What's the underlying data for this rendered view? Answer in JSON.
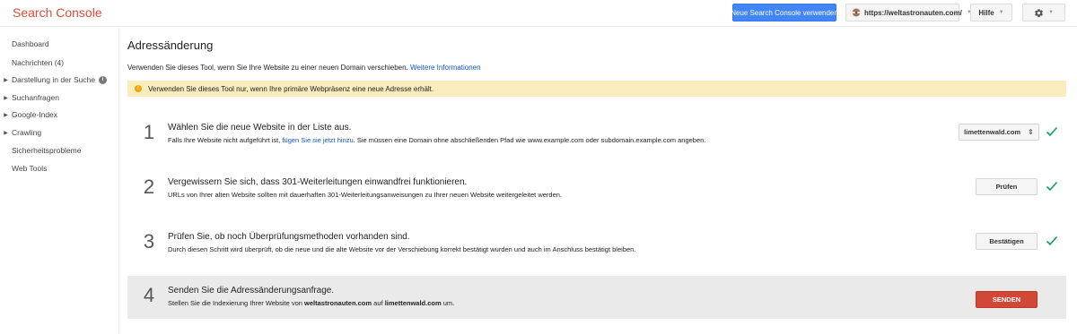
{
  "header": {
    "app_title": "Search Console",
    "new_console_button": "Neue Search Console verwenden",
    "site_selector": "https://weltastronauten.com/",
    "help_button": "Hilfe",
    "settings_icon": "gear-icon",
    "brand_color": "#dd4b39",
    "accent_color": "#4285f4"
  },
  "sidebar": {
    "items": [
      {
        "label": "Dashboard",
        "expandable": false
      },
      {
        "label": "Nachrichten (4)",
        "expandable": false
      },
      {
        "label": "Darstellung in der Suche",
        "expandable": true,
        "info_icon": true
      },
      {
        "label": "Suchanfragen",
        "expandable": true
      },
      {
        "label": "Google-Index",
        "expandable": true
      },
      {
        "label": "Crawling",
        "expandable": true
      },
      {
        "label": "Sicherheitsprobleme",
        "expandable": false
      },
      {
        "label": "Web Tools",
        "expandable": false
      }
    ]
  },
  "main": {
    "title": "Adressänderung",
    "intro_text": "Verwenden Sie dieses Tool, wenn Sie Ihre Website zu einer neuen Domain verschieben.",
    "intro_link": "Weitere Informationen",
    "warning": "Verwenden Sie dieses Tool nur, wenn Ihre primäre Webpräsenz eine neue Adresse erhält.",
    "steps": [
      {
        "number": "1",
        "title": "Wählen Sie die neue Website in der Liste aus.",
        "desc_before": "Falls Ihre Website nicht aufgeführt ist,",
        "desc_link": "fügen Sie sie jetzt hinzu",
        "desc_after": ". Sie müssen eine Domain ohne abschließenden Pfad wie www.example.com oder subdomain.example.com angeben.",
        "control": "limettenwald.com",
        "done": true
      },
      {
        "number": "2",
        "title": "Vergewissern Sie sich, dass 301-Weiterleitungen einwandfrei funktionieren.",
        "desc": "URLs von Ihrer alten Website sollten mit dauerhaften 301-Weiterleitungsanweisungen zu Ihrer neuen Website weitergeleitet werden.",
        "control": "Prüfen",
        "done": true
      },
      {
        "number": "3",
        "title": "Prüfen Sie, ob noch Überprüfungsmethoden vorhanden sind.",
        "desc": "Durch diesen Schritt wird überprüft, ob die neue und die alte Website vor der Verschiebung korrekt bestätigt wurden und auch im Anschluss bestätigt bleiben.",
        "control": "Bestätigen",
        "done": true
      },
      {
        "number": "4",
        "title": "Senden Sie die Adressänderungsanfrage.",
        "desc_before": "Stellen Sie die Indexierung Ihrer Website von",
        "old_site": "weltastronauten.com",
        "desc_middle": "auf",
        "new_site": "limettenwald.com",
        "desc_after": "um.",
        "control": "SENDEN"
      }
    ],
    "check_color": "#0f9d58",
    "send_color": "#d14836"
  }
}
